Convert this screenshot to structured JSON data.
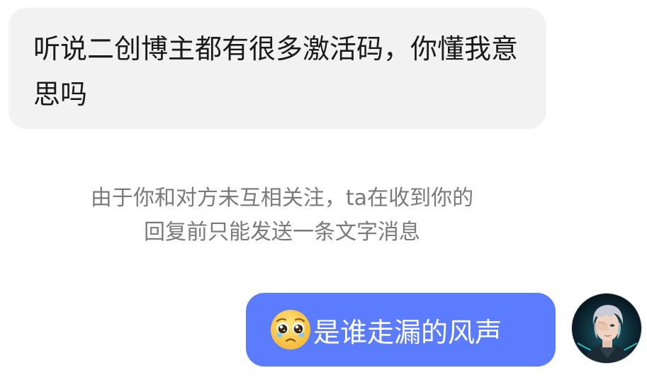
{
  "incoming_message": {
    "text": "听说二创博主都有很多激活码，你懂我意思吗"
  },
  "system_notice": {
    "line1": "由于你和对方未互相关注，ta在收到你的",
    "line2": "回复前只能发送一条文字消息"
  },
  "outgoing_message": {
    "emoji": "pleading-face-with-tears-icon",
    "text": "是谁走漏的风声"
  },
  "colors": {
    "incoming_bubble": "#f2f2f2",
    "outgoing_bubble": "#5b7cff",
    "notice_text": "#7a7a7a"
  }
}
